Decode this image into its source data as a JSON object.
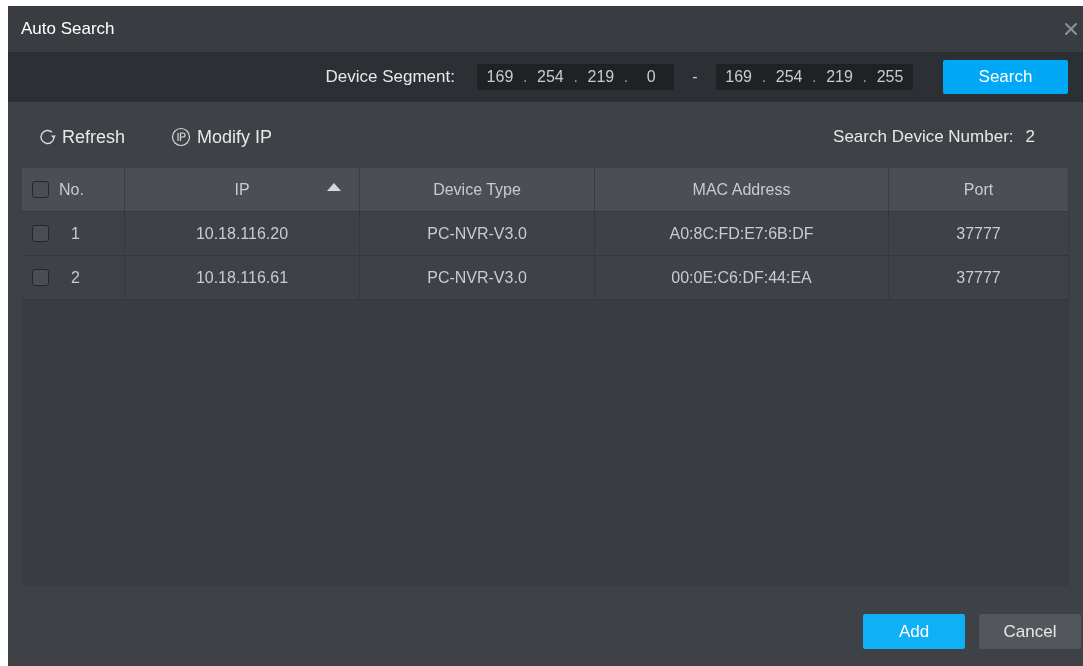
{
  "window": {
    "title": "Auto Search"
  },
  "segment": {
    "label": "Device Segment:",
    "start": [
      {
        "value": "169"
      },
      {
        "separator": ".",
        "value": "254"
      },
      {
        "separator": ".",
        "value": "219"
      },
      {
        "separator": ".",
        "value": "0"
      }
    ],
    "dash": "-",
    "end": [
      {
        "value": "169"
      },
      {
        "separator": ".",
        "value": "254"
      },
      {
        "separator": ".",
        "value": "219"
      },
      {
        "separator": ".",
        "value": "255"
      }
    ],
    "search_button": "Search"
  },
  "toolbar": {
    "refresh": "Refresh",
    "modify_ip": "Modify IP",
    "count_label": "Search Device Number:",
    "count": "2"
  },
  "table": {
    "select_all_checked": false,
    "columns": [
      {
        "label": "No.",
        "sorted_ascending": false
      },
      {
        "label": "IP",
        "sorted_ascending": true
      },
      {
        "label": "Device Type",
        "sorted_ascending": false
      },
      {
        "label": "MAC Address",
        "sorted_ascending": false
      },
      {
        "label": "Port",
        "sorted_ascending": false
      }
    ],
    "rows": [
      {
        "checked": false,
        "cells": [
          "1",
          "10.18.116.20",
          "PC-NVR-V3.0",
          "A0:8C:FD:E7:6B:DF",
          "37777"
        ]
      },
      {
        "checked": false,
        "cells": [
          "2",
          "10.18.116.61",
          "PC-NVR-V3.0",
          "00:0E:C6:DF:44:EA",
          "37777"
        ]
      }
    ]
  },
  "buttons": [
    {
      "kind": "primary",
      "label": "Add"
    },
    {
      "kind": "secondary",
      "label": "Cancel"
    }
  ]
}
